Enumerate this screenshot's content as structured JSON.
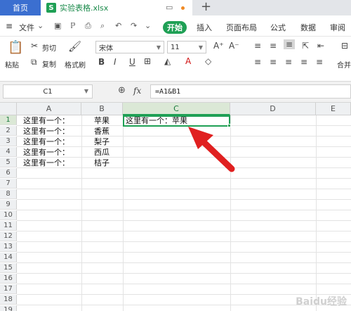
{
  "tabs": {
    "home": "首页",
    "file_icon": "S",
    "file_name": "实验表格.xlsx",
    "new_tab": "+"
  },
  "menu": {
    "file": "文件",
    "start": "开始",
    "insert": "插入",
    "layout": "页面布局",
    "formula": "公式",
    "data": "数据",
    "review": "审阅"
  },
  "ribbon": {
    "paste": "粘贴",
    "cut": "剪切",
    "copy": "复制",
    "format_painter": "格式刷",
    "font_name": "宋体",
    "font_size": "11",
    "merge": "合并"
  },
  "formula_bar": {
    "cell_ref": "C1",
    "fx": "fx",
    "formula": "=A1&B1"
  },
  "columns": [
    "A",
    "B",
    "C",
    "D",
    "E"
  ],
  "rows": [
    "1",
    "2",
    "3",
    "4",
    "5",
    "6",
    "7",
    "8",
    "9",
    "10",
    "11",
    "12",
    "13",
    "14",
    "15",
    "16",
    "17",
    "18",
    "19"
  ],
  "cells": {
    "A": [
      "这里有一个：",
      "这里有一个：",
      "这里有一个：",
      "这里有一个：",
      "这里有一个："
    ],
    "B": [
      "苹果",
      "香蕉",
      "梨子",
      "西瓜",
      "桔子"
    ],
    "C1": "这里有一个：苹果"
  },
  "watermark": "Baidu经验",
  "colors": {
    "accent": "#1fa055",
    "arrow": "#e02020"
  }
}
